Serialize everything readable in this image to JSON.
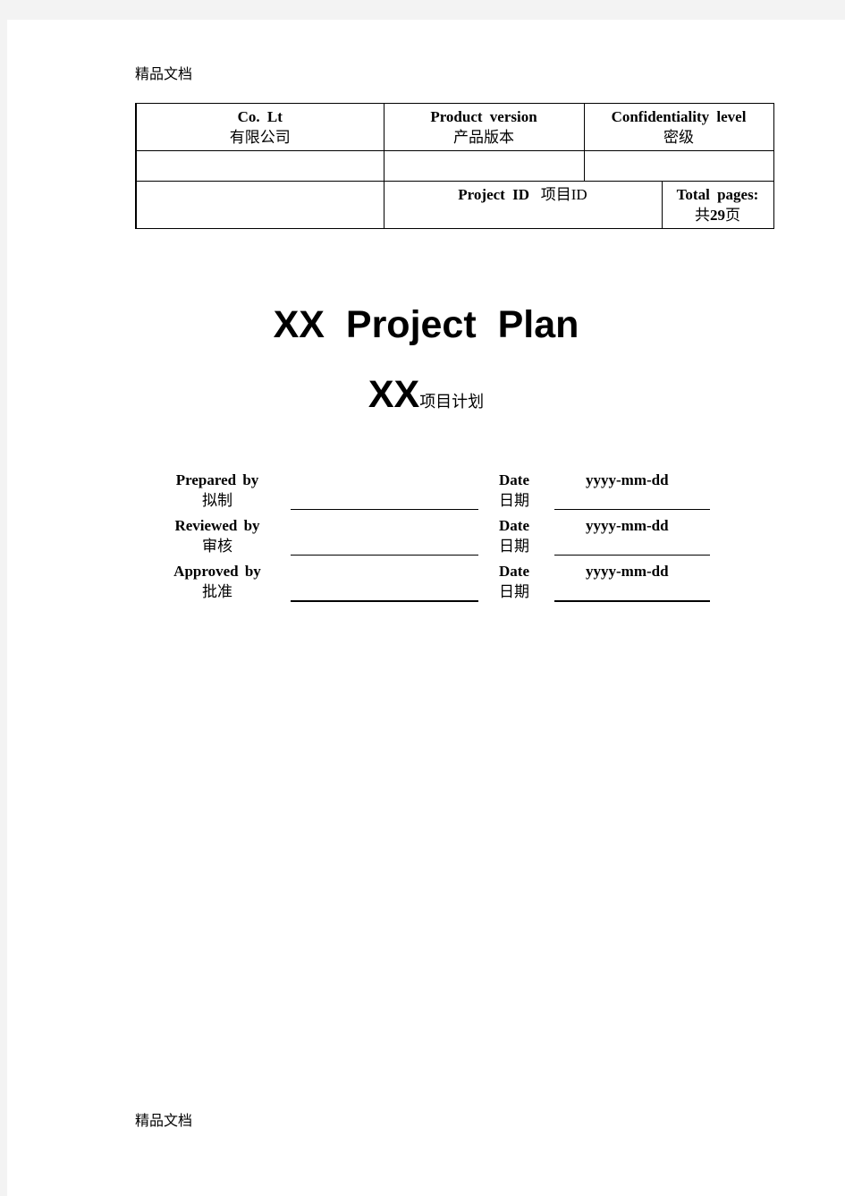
{
  "watermark": {
    "top": "精品文档",
    "bottom": "精品文档"
  },
  "info_table": {
    "company": {
      "en": "Co. Lt",
      "cn": "有限公司"
    },
    "product_version": {
      "en": "Product version",
      "cn": "产品版本"
    },
    "confidentiality": {
      "en": "Confidentiality level",
      "cn": "密级"
    },
    "project_id": {
      "en": "Project ID",
      "cn": "项目ID"
    },
    "total_pages": {
      "en": "Total pages:",
      "cn_prefix": "共",
      "count": "29",
      "cn_suffix": "页"
    },
    "company_value": "",
    "product_version_value": "",
    "confidentiality_value": ""
  },
  "title": {
    "en": "XX Project Plan",
    "sub_prefix": "XX",
    "sub_cn": "项目计划"
  },
  "signatures": [
    {
      "role_en": "Prepared by",
      "role_cn": "拟制",
      "date_en": "Date",
      "date_cn": "日期",
      "date_value": "yyyy-mm-dd"
    },
    {
      "role_en": "Reviewed by",
      "role_cn": "审核",
      "date_en": "Date",
      "date_cn": "日期",
      "date_value": "yyyy-mm-dd"
    },
    {
      "role_en": "Approved by",
      "role_cn": "批准",
      "date_en": "Date",
      "date_cn": "日期",
      "date_value": "yyyy-mm-dd"
    }
  ]
}
